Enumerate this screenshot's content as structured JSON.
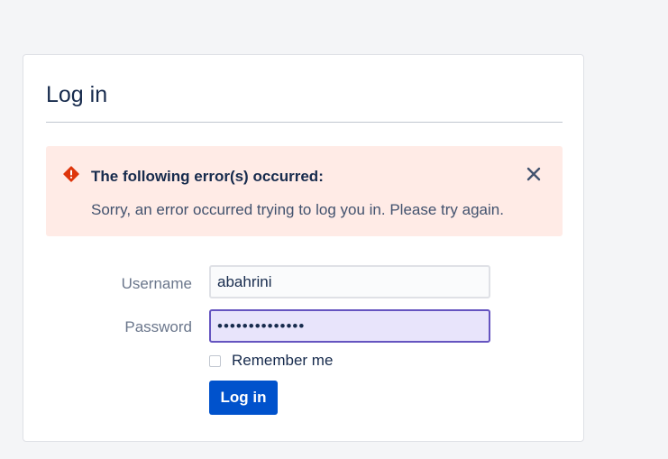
{
  "login": {
    "title": "Log in",
    "error": {
      "icon": "error-icon",
      "title": "The following error(s) occurred:",
      "message": "Sorry, an error occurred trying to log you in. Please try again.",
      "close_icon": "close-icon"
    },
    "username": {
      "label": "Username",
      "value": "abahrini"
    },
    "password": {
      "label": "Password",
      "value": "••••••••••••••"
    },
    "remember": {
      "label": "Remember me",
      "checked": false
    },
    "submit_label": "Log in"
  },
  "colors": {
    "background": "#f4f5f7",
    "error_background": "#ffebe6",
    "error_icon": "#de350b",
    "primary_button": "#0052cc",
    "password_focus_border": "#6554c0",
    "password_fill": "#e8e4fb"
  }
}
